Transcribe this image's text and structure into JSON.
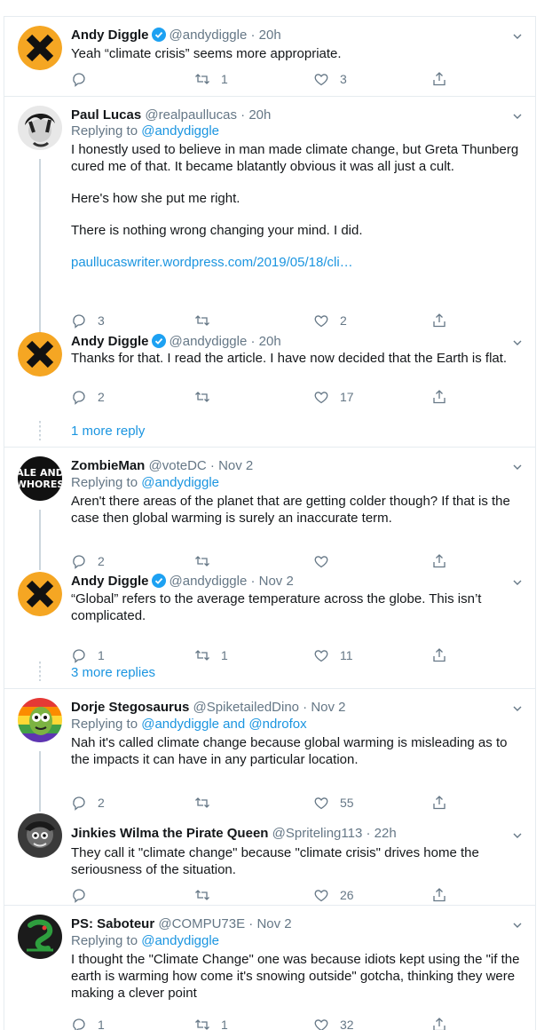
{
  "tweets": [
    {
      "name": "Andy Diggle",
      "handle": "@andydiggle · 20h",
      "replying_prefix": "",
      "replying_to": "",
      "body": [
        "Yeah “climate crisis” seems more appropriate."
      ],
      "replies": "",
      "retweets": "1",
      "likes": "3"
    },
    {
      "name": "Paul Lucas",
      "handle": "@realpaullucas · 20h",
      "replying_prefix": "Replying to ",
      "replying_to": "@andydiggle",
      "body": [
        "I honestly used to believe in man made climate change, but Greta Thunberg cured me of that. It became blatantly obvious it was all just a cult.",
        "Here's how she put me right.",
        "There is nothing wrong changing your mind. I did."
      ],
      "link": "paullucaswriter.wordpress.com/2019/05/18/cli…",
      "replies": "3",
      "retweets": "",
      "likes": "2"
    },
    {
      "name": "Andy Diggle",
      "handle": "@andydiggle · 20h",
      "replying_prefix": "",
      "replying_to": "",
      "body": [
        "Thanks for that. I read the article. I have now decided that the Earth is flat."
      ],
      "replies": "2",
      "retweets": "",
      "likes": "17"
    },
    {
      "name": "ZombieMan",
      "handle": "@voteDC · Nov 2",
      "replying_prefix": "Replying to ",
      "replying_to": "@andydiggle",
      "body": [
        "Aren't there areas of the planet that are getting colder though? If that is the case then global warming is surely an inaccurate term."
      ],
      "replies": "2",
      "retweets": "",
      "likes": ""
    },
    {
      "name": "Andy Diggle",
      "handle": "@andydiggle · Nov 2",
      "replying_prefix": "",
      "replying_to": "",
      "body": [
        "“Global” refers to the average temperature across the globe. This isn’t complicated."
      ],
      "replies": "1",
      "retweets": "1",
      "likes": "11"
    },
    {
      "name": "Dorje Stegosaurus",
      "handle": "@SpiketailedDino · Nov 2",
      "replying_prefix": "Replying to ",
      "replying_to": "@andydiggle and @ndrofox",
      "body": [
        "Nah it's called climate change because global warming is misleading as to the impacts it can have in any particular location."
      ],
      "replies": "2",
      "retweets": "",
      "likes": "55"
    },
    {
      "name": "Jinkies Wilma the Pirate Queen",
      "handle": "@Spriteling113 · 22h",
      "replying_prefix": "",
      "replying_to": "",
      "body": [
        "They call it \"climate change\"  because \"climate crisis\" drives home the seriousness of the situation."
      ],
      "replies": "",
      "retweets": "",
      "likes": "26"
    },
    {
      "name": "PS: Saboteur",
      "handle": "@COMPU73E · Nov 2",
      "replying_prefix": "Replying to ",
      "replying_to": "@andydiggle",
      "body": [
        "I thought the \"Climate Change\" one was because idiots kept using the \"if the earth is warming how come it's snowing outside\" gotcha, thinking they were making a clever point"
      ],
      "replies": "1",
      "retweets": "1",
      "likes": "32"
    }
  ],
  "more_replies": [
    "1 more reply",
    "3 more replies"
  ],
  "avatar_zombie_text": [
    "ALE AND",
    "WHORES"
  ],
  "icons": [
    "verified-badge-icon",
    "chevron-down-icon",
    "reply-icon",
    "retweet-icon",
    "like-icon",
    "share-icon"
  ],
  "colors": {
    "accent": "#1b95e0",
    "muted": "#657786",
    "verified": "#1da1f2",
    "divider": "#e6ecf0",
    "x_avatar_bg": "#f5a623"
  }
}
